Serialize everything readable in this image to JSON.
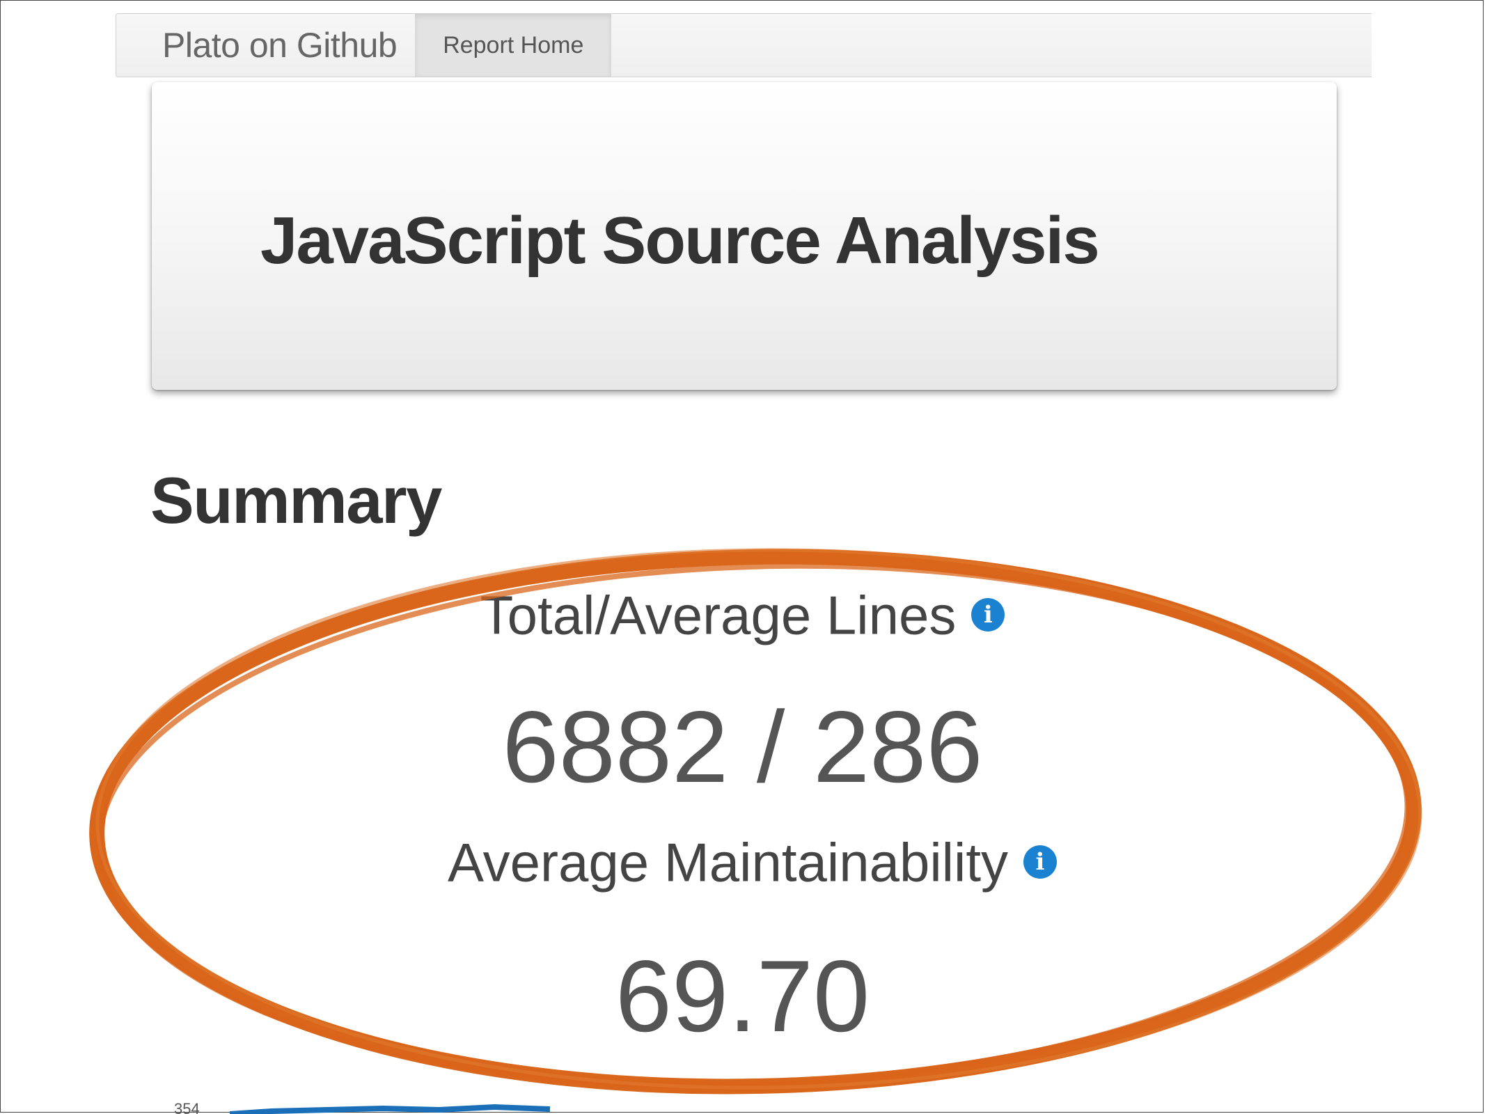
{
  "navbar": {
    "brand": "Plato on Github",
    "tab_report_home": "Report Home"
  },
  "hero": {
    "title": "JavaScript Source Analysis"
  },
  "summary": {
    "heading": "Summary",
    "total_average_lines": {
      "label": "Total/Average Lines",
      "value": "6882 / 286"
    },
    "average_maintainability": {
      "label": "Average Maintainability",
      "value": "69.70"
    },
    "chart_tick_label": "354"
  },
  "annotation": {
    "highlight_color": "#d9661b"
  },
  "colors": {
    "info_icon": "#1a82d0"
  }
}
